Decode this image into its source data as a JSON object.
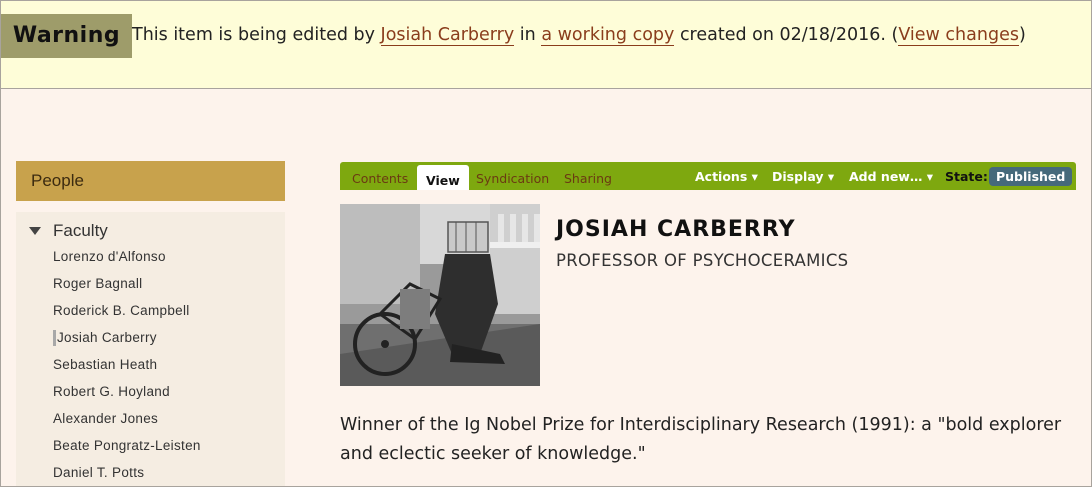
{
  "warning": {
    "label": "Warning",
    "text_1": "This item is being edited by ",
    "editor_link": "Josiah Carberry",
    "text_2": " in ",
    "copy_link": "a working copy",
    "text_3": " created on 02/18/2016. (",
    "changes_link": "View changes",
    "text_4": ")"
  },
  "sidebar": {
    "title": "People",
    "group": "Faculty",
    "items": [
      "Lorenzo d'Alfonso",
      "Roger Bagnall",
      "Roderick B. Campbell",
      "Josiah Carberry",
      "Sebastian Heath",
      "Robert G. Hoyland",
      "Alexander Jones",
      "Beate Pongratz-Leisten",
      "Daniel T. Potts"
    ]
  },
  "toolbar": {
    "tabs": [
      "Contents",
      "View",
      "Syndication",
      "Sharing"
    ],
    "actions": "Actions ▾",
    "display": "Display ▾",
    "add_new": "Add new… ▾",
    "state_label": "State:",
    "state_value": "Published"
  },
  "profile": {
    "name": "JOSIAH CARBERRY",
    "title": "PROFESSOR OF PSYCHOCERAMICS",
    "bio": "Winner of the Ig Nobel Prize for Interdisciplinary Research (1991): a \"bold explorer and eclectic seeker of knowledge.\""
  },
  "colors": {
    "warning_bg": "#fefdd8",
    "link": "#8a3d1c",
    "toolbar_green": "#7ea80f",
    "state_badge": "#45697b",
    "sidebar_header": "#c8a24c"
  }
}
